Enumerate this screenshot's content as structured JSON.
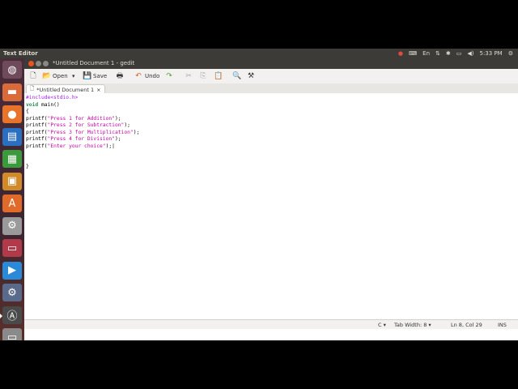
{
  "panel": {
    "app_title": "Text Editor",
    "indicators": [
      "●",
      "⌨",
      "En",
      "⇅",
      "✱",
      "▭",
      "◀)",
      "5:33 PM",
      "⚙"
    ]
  },
  "launcher": {
    "items": [
      {
        "name": "dash-icon",
        "glyph": "◍",
        "color": "#6e4a5a"
      },
      {
        "name": "files-icon",
        "glyph": "▬",
        "color": "#d96a3a"
      },
      {
        "name": "firefox-icon",
        "glyph": "●",
        "color": "#e8732a"
      },
      {
        "name": "writer-icon",
        "glyph": "▤",
        "color": "#2a6fc0"
      },
      {
        "name": "calc-icon",
        "glyph": "▦",
        "color": "#3b9a3b"
      },
      {
        "name": "impress-icon",
        "glyph": "▣",
        "color": "#d08a2a"
      },
      {
        "name": "software-center-icon",
        "glyph": "A",
        "color": "#e06a2a"
      },
      {
        "name": "settings-icon",
        "glyph": "⚙",
        "color": "#9a9a9a"
      },
      {
        "name": "media-icon",
        "glyph": "▭",
        "color": "#b03a4a"
      },
      {
        "name": "player-icon",
        "glyph": "▶",
        "color": "#2a8ad8"
      },
      {
        "name": "installer-icon",
        "glyph": "⚙",
        "color": "#5a6a8a"
      },
      {
        "name": "gedit-icon",
        "glyph": "Ⓐ",
        "color": "#4a4a4a"
      },
      {
        "name": "trash-icon",
        "glyph": "▭",
        "color": "#8a8a8a"
      }
    ]
  },
  "window": {
    "title": "*Untitled Document 1 - gedit",
    "buttons": {
      "close_color": "#e95420",
      "min_color": "#8a8681",
      "max_color": "#8a8681"
    }
  },
  "toolbar": {
    "new_icon": "🗋",
    "open_icon": "📂",
    "open_label": "Open",
    "open_arrow": "▾",
    "save_icon": "💾",
    "save_label": "Save",
    "print_icon": "🖶",
    "undo_icon": "↶",
    "undo_label": "Undo",
    "redo_icon": "↷",
    "cut_icon": "✂",
    "copy_icon": "⎘",
    "paste_icon": "📋",
    "find_icon": "🔍",
    "replace_icon": "⚒"
  },
  "tab": {
    "icon": "🗋",
    "label": "*Untitled Document 1",
    "close": "×"
  },
  "code": {
    "lines": [
      [
        {
          "c": "tok-pre",
          "t": "#include<stdio.h>"
        }
      ],
      [
        {
          "c": "tok-kw",
          "t": "void"
        },
        {
          "c": "tok-plain",
          "t": " main()"
        }
      ],
      [
        {
          "c": "tok-plain",
          "t": "{"
        }
      ],
      [
        {
          "c": "tok-plain",
          "t": "printf("
        },
        {
          "c": "tok-str",
          "t": "\"Press 1 for Addition\""
        },
        {
          "c": "tok-plain",
          "t": ");"
        }
      ],
      [
        {
          "c": "tok-plain",
          "t": "printf("
        },
        {
          "c": "tok-str",
          "t": "\"Press 2 for Subtraction\""
        },
        {
          "c": "tok-plain",
          "t": ");"
        }
      ],
      [
        {
          "c": "tok-plain",
          "t": "printf("
        },
        {
          "c": "tok-str",
          "t": "\"Press 3 for Multiplication\""
        },
        {
          "c": "tok-plain",
          "t": ");"
        }
      ],
      [
        {
          "c": "tok-plain",
          "t": "printf("
        },
        {
          "c": "tok-str",
          "t": "\"Press 4 for Division\""
        },
        {
          "c": "tok-plain",
          "t": ");"
        }
      ],
      [
        {
          "c": "tok-plain",
          "t": "printf("
        },
        {
          "c": "tok-str",
          "t": "\"Enter your choice\""
        },
        {
          "c": "tok-plain",
          "t": ");|"
        }
      ],
      [],
      [],
      [
        {
          "c": "tok-plain",
          "t": "}"
        }
      ]
    ]
  },
  "status": {
    "language": "C ▾",
    "tab_width": "Tab Width: 8 ▾",
    "position": "Ln 8, Col 29",
    "mode": "INS"
  }
}
